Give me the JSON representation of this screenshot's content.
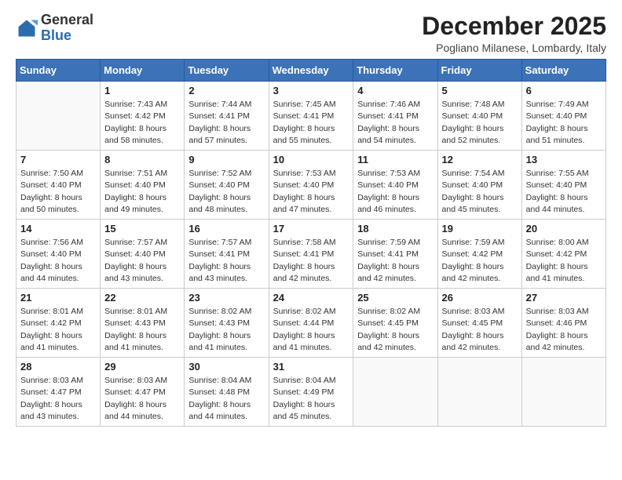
{
  "header": {
    "logo": {
      "general": "General",
      "blue": "Blue"
    },
    "title": "December 2025",
    "location": "Pogliano Milanese, Lombardy, Italy"
  },
  "calendar": {
    "days_of_week": [
      "Sunday",
      "Monday",
      "Tuesday",
      "Wednesday",
      "Thursday",
      "Friday",
      "Saturday"
    ],
    "weeks": [
      [
        {
          "day": "",
          "sunrise": "",
          "sunset": "",
          "daylight": ""
        },
        {
          "day": "1",
          "sunrise": "Sunrise: 7:43 AM",
          "sunset": "Sunset: 4:42 PM",
          "daylight": "Daylight: 8 hours and 58 minutes."
        },
        {
          "day": "2",
          "sunrise": "Sunrise: 7:44 AM",
          "sunset": "Sunset: 4:41 PM",
          "daylight": "Daylight: 8 hours and 57 minutes."
        },
        {
          "day": "3",
          "sunrise": "Sunrise: 7:45 AM",
          "sunset": "Sunset: 4:41 PM",
          "daylight": "Daylight: 8 hours and 55 minutes."
        },
        {
          "day": "4",
          "sunrise": "Sunrise: 7:46 AM",
          "sunset": "Sunset: 4:41 PM",
          "daylight": "Daylight: 8 hours and 54 minutes."
        },
        {
          "day": "5",
          "sunrise": "Sunrise: 7:48 AM",
          "sunset": "Sunset: 4:40 PM",
          "daylight": "Daylight: 8 hours and 52 minutes."
        },
        {
          "day": "6",
          "sunrise": "Sunrise: 7:49 AM",
          "sunset": "Sunset: 4:40 PM",
          "daylight": "Daylight: 8 hours and 51 minutes."
        }
      ],
      [
        {
          "day": "7",
          "sunrise": "Sunrise: 7:50 AM",
          "sunset": "Sunset: 4:40 PM",
          "daylight": "Daylight: 8 hours and 50 minutes."
        },
        {
          "day": "8",
          "sunrise": "Sunrise: 7:51 AM",
          "sunset": "Sunset: 4:40 PM",
          "daylight": "Daylight: 8 hours and 49 minutes."
        },
        {
          "day": "9",
          "sunrise": "Sunrise: 7:52 AM",
          "sunset": "Sunset: 4:40 PM",
          "daylight": "Daylight: 8 hours and 48 minutes."
        },
        {
          "day": "10",
          "sunrise": "Sunrise: 7:53 AM",
          "sunset": "Sunset: 4:40 PM",
          "daylight": "Daylight: 8 hours and 47 minutes."
        },
        {
          "day": "11",
          "sunrise": "Sunrise: 7:53 AM",
          "sunset": "Sunset: 4:40 PM",
          "daylight": "Daylight: 8 hours and 46 minutes."
        },
        {
          "day": "12",
          "sunrise": "Sunrise: 7:54 AM",
          "sunset": "Sunset: 4:40 PM",
          "daylight": "Daylight: 8 hours and 45 minutes."
        },
        {
          "day": "13",
          "sunrise": "Sunrise: 7:55 AM",
          "sunset": "Sunset: 4:40 PM",
          "daylight": "Daylight: 8 hours and 44 minutes."
        }
      ],
      [
        {
          "day": "14",
          "sunrise": "Sunrise: 7:56 AM",
          "sunset": "Sunset: 4:40 PM",
          "daylight": "Daylight: 8 hours and 44 minutes."
        },
        {
          "day": "15",
          "sunrise": "Sunrise: 7:57 AM",
          "sunset": "Sunset: 4:40 PM",
          "daylight": "Daylight: 8 hours and 43 minutes."
        },
        {
          "day": "16",
          "sunrise": "Sunrise: 7:57 AM",
          "sunset": "Sunset: 4:41 PM",
          "daylight": "Daylight: 8 hours and 43 minutes."
        },
        {
          "day": "17",
          "sunrise": "Sunrise: 7:58 AM",
          "sunset": "Sunset: 4:41 PM",
          "daylight": "Daylight: 8 hours and 42 minutes."
        },
        {
          "day": "18",
          "sunrise": "Sunrise: 7:59 AM",
          "sunset": "Sunset: 4:41 PM",
          "daylight": "Daylight: 8 hours and 42 minutes."
        },
        {
          "day": "19",
          "sunrise": "Sunrise: 7:59 AM",
          "sunset": "Sunset: 4:42 PM",
          "daylight": "Daylight: 8 hours and 42 minutes."
        },
        {
          "day": "20",
          "sunrise": "Sunrise: 8:00 AM",
          "sunset": "Sunset: 4:42 PM",
          "daylight": "Daylight: 8 hours and 41 minutes."
        }
      ],
      [
        {
          "day": "21",
          "sunrise": "Sunrise: 8:01 AM",
          "sunset": "Sunset: 4:42 PM",
          "daylight": "Daylight: 8 hours and 41 minutes."
        },
        {
          "day": "22",
          "sunrise": "Sunrise: 8:01 AM",
          "sunset": "Sunset: 4:43 PM",
          "daylight": "Daylight: 8 hours and 41 minutes."
        },
        {
          "day": "23",
          "sunrise": "Sunrise: 8:02 AM",
          "sunset": "Sunset: 4:43 PM",
          "daylight": "Daylight: 8 hours and 41 minutes."
        },
        {
          "day": "24",
          "sunrise": "Sunrise: 8:02 AM",
          "sunset": "Sunset: 4:44 PM",
          "daylight": "Daylight: 8 hours and 41 minutes."
        },
        {
          "day": "25",
          "sunrise": "Sunrise: 8:02 AM",
          "sunset": "Sunset: 4:45 PM",
          "daylight": "Daylight: 8 hours and 42 minutes."
        },
        {
          "day": "26",
          "sunrise": "Sunrise: 8:03 AM",
          "sunset": "Sunset: 4:45 PM",
          "daylight": "Daylight: 8 hours and 42 minutes."
        },
        {
          "day": "27",
          "sunrise": "Sunrise: 8:03 AM",
          "sunset": "Sunset: 4:46 PM",
          "daylight": "Daylight: 8 hours and 42 minutes."
        }
      ],
      [
        {
          "day": "28",
          "sunrise": "Sunrise: 8:03 AM",
          "sunset": "Sunset: 4:47 PM",
          "daylight": "Daylight: 8 hours and 43 minutes."
        },
        {
          "day": "29",
          "sunrise": "Sunrise: 8:03 AM",
          "sunset": "Sunset: 4:47 PM",
          "daylight": "Daylight: 8 hours and 44 minutes."
        },
        {
          "day": "30",
          "sunrise": "Sunrise: 8:04 AM",
          "sunset": "Sunset: 4:48 PM",
          "daylight": "Daylight: 8 hours and 44 minutes."
        },
        {
          "day": "31",
          "sunrise": "Sunrise: 8:04 AM",
          "sunset": "Sunset: 4:49 PM",
          "daylight": "Daylight: 8 hours and 45 minutes."
        },
        {
          "day": "",
          "sunrise": "",
          "sunset": "",
          "daylight": ""
        },
        {
          "day": "",
          "sunrise": "",
          "sunset": "",
          "daylight": ""
        },
        {
          "day": "",
          "sunrise": "",
          "sunset": "",
          "daylight": ""
        }
      ]
    ]
  }
}
